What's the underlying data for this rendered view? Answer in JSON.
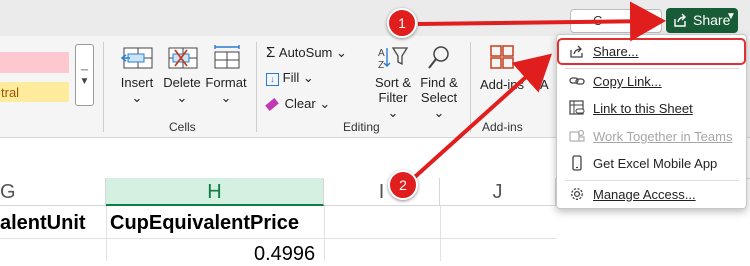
{
  "titlebar": {
    "comments_label": "C",
    "share_label": "Share"
  },
  "ribbon": {
    "styles": {
      "neutral_label": "tral"
    },
    "cells": {
      "insert": "Insert",
      "delete": "Delete",
      "format": "Format",
      "group": "Cells"
    },
    "editing": {
      "autosum": "AutoSum",
      "fill": "Fill",
      "clear": "Clear",
      "sort_line1": "Sort &",
      "sort_line2": "Filter",
      "find_line1": "Find &",
      "find_line2": "Select",
      "group": "Editing"
    },
    "addins": {
      "addins": "Add-ins",
      "partial": "A",
      "group": "Add-ins"
    }
  },
  "sheet": {
    "columns": [
      "G",
      "H",
      "I",
      "J"
    ],
    "header_row": [
      "alentUnit",
      "CupEquivalentPrice"
    ],
    "row2_h": "0.4996"
  },
  "share_menu": {
    "items": [
      {
        "label": "Share...",
        "icon": "share-icon"
      },
      {
        "label": "Copy Link...",
        "icon": "link-icon"
      },
      {
        "label": "Link to this Sheet",
        "icon": "sheet-link-icon"
      },
      {
        "label": "Work Together in Teams",
        "icon": "teams-icon"
      },
      {
        "label": "Get Excel Mobile App",
        "icon": "mobile-icon"
      },
      {
        "label": "Manage Access...",
        "icon": "gear-icon"
      }
    ]
  },
  "annotations": {
    "step1": "1",
    "step2": "2",
    "arrow_color": "#e01e1e"
  },
  "colors": {
    "share_button": "#185c37",
    "selected_column": "#107c41",
    "accent_red": "#e03030"
  }
}
